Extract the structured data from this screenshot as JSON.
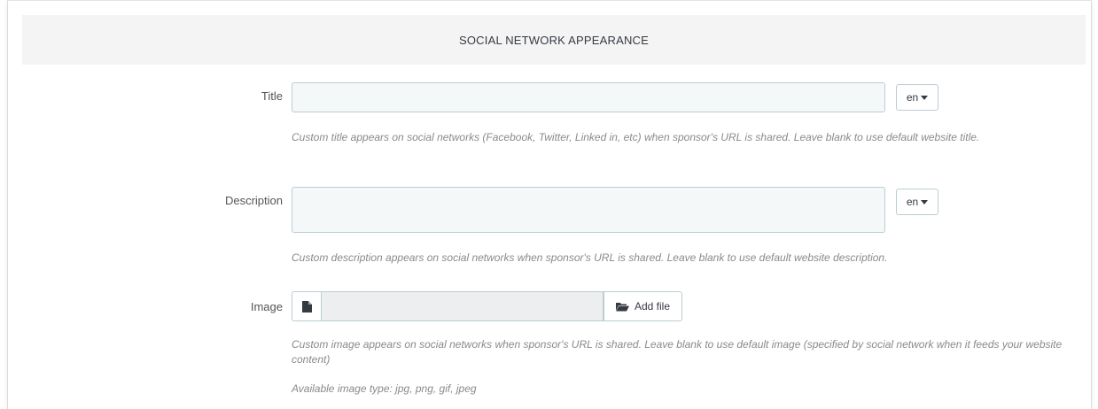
{
  "section": {
    "title": "SOCIAL NETWORK APPEARANCE"
  },
  "fields": {
    "title": {
      "label": "Title",
      "value": "",
      "lang": "en",
      "help": "Custom title appears on social networks (Facebook, Twitter, Linked in, etc) when sponsor's URL is shared. Leave blank to use default website title."
    },
    "description": {
      "label": "Description",
      "value": "",
      "lang": "en",
      "help": "Custom description appears on social networks when sponsor's URL is shared. Leave blank to use default website description."
    },
    "image": {
      "label": "Image",
      "file_value": "",
      "add_file_label": "Add file",
      "help": "Custom image appears on social networks when sponsor's URL is shared. Leave blank to use default image (specified by social network when it feeds your website content)",
      "types_note": "Available image type: jpg, png, gif, jpeg"
    }
  },
  "icons": {
    "file": "file-icon",
    "folder": "folder-open-icon",
    "caret": "caret-down-icon"
  },
  "colors": {
    "header_bg": "#f4f4f4",
    "input_bg": "#f5f8f9",
    "input_border": "#bbcdd2",
    "help_text": "#8a8a8a"
  }
}
